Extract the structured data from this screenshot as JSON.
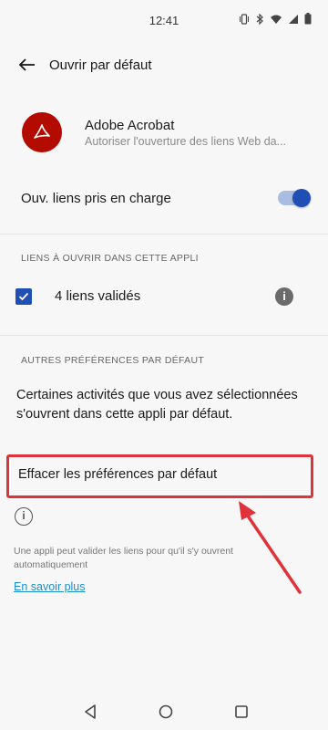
{
  "status_bar": {
    "time": "12:41",
    "icons": [
      "vibrate-icon",
      "bluetooth-icon",
      "wifi-icon",
      "signal-icon",
      "battery-icon"
    ]
  },
  "app_bar": {
    "title": "Ouvrir par défaut",
    "back_icon": "arrow-back-icon"
  },
  "app": {
    "name": "Adobe Acrobat",
    "description": "Autoriser l'ouverture des liens Web da..."
  },
  "supported_links": {
    "label": "Ouv. liens pris en charge",
    "enabled": true
  },
  "links_section": {
    "header": "LIENS À OUVRIR DANS CETTE APPLI",
    "verified_label": "4 liens validés",
    "checked": true
  },
  "other_section": {
    "header": "AUTRES PRÉFÉRENCES PAR DÉFAUT",
    "body": "Certaines activités que vous avez sélectionnées s'ouvrent dans cette appli par défaut."
  },
  "clear_defaults": {
    "label": "Effacer les préférences par défaut"
  },
  "footnote": {
    "text": "Une appli peut valider les liens pour qu'il s'y ouvrent automatiquement",
    "link": "En savoir plus"
  },
  "colors": {
    "accent": "#1f4fb5",
    "highlight": "#e0323a",
    "link": "#1d8fd0",
    "brand": "#b30b00"
  },
  "nav": {
    "items": [
      "back-nav-icon",
      "home-nav-icon",
      "recents-nav-icon"
    ]
  }
}
